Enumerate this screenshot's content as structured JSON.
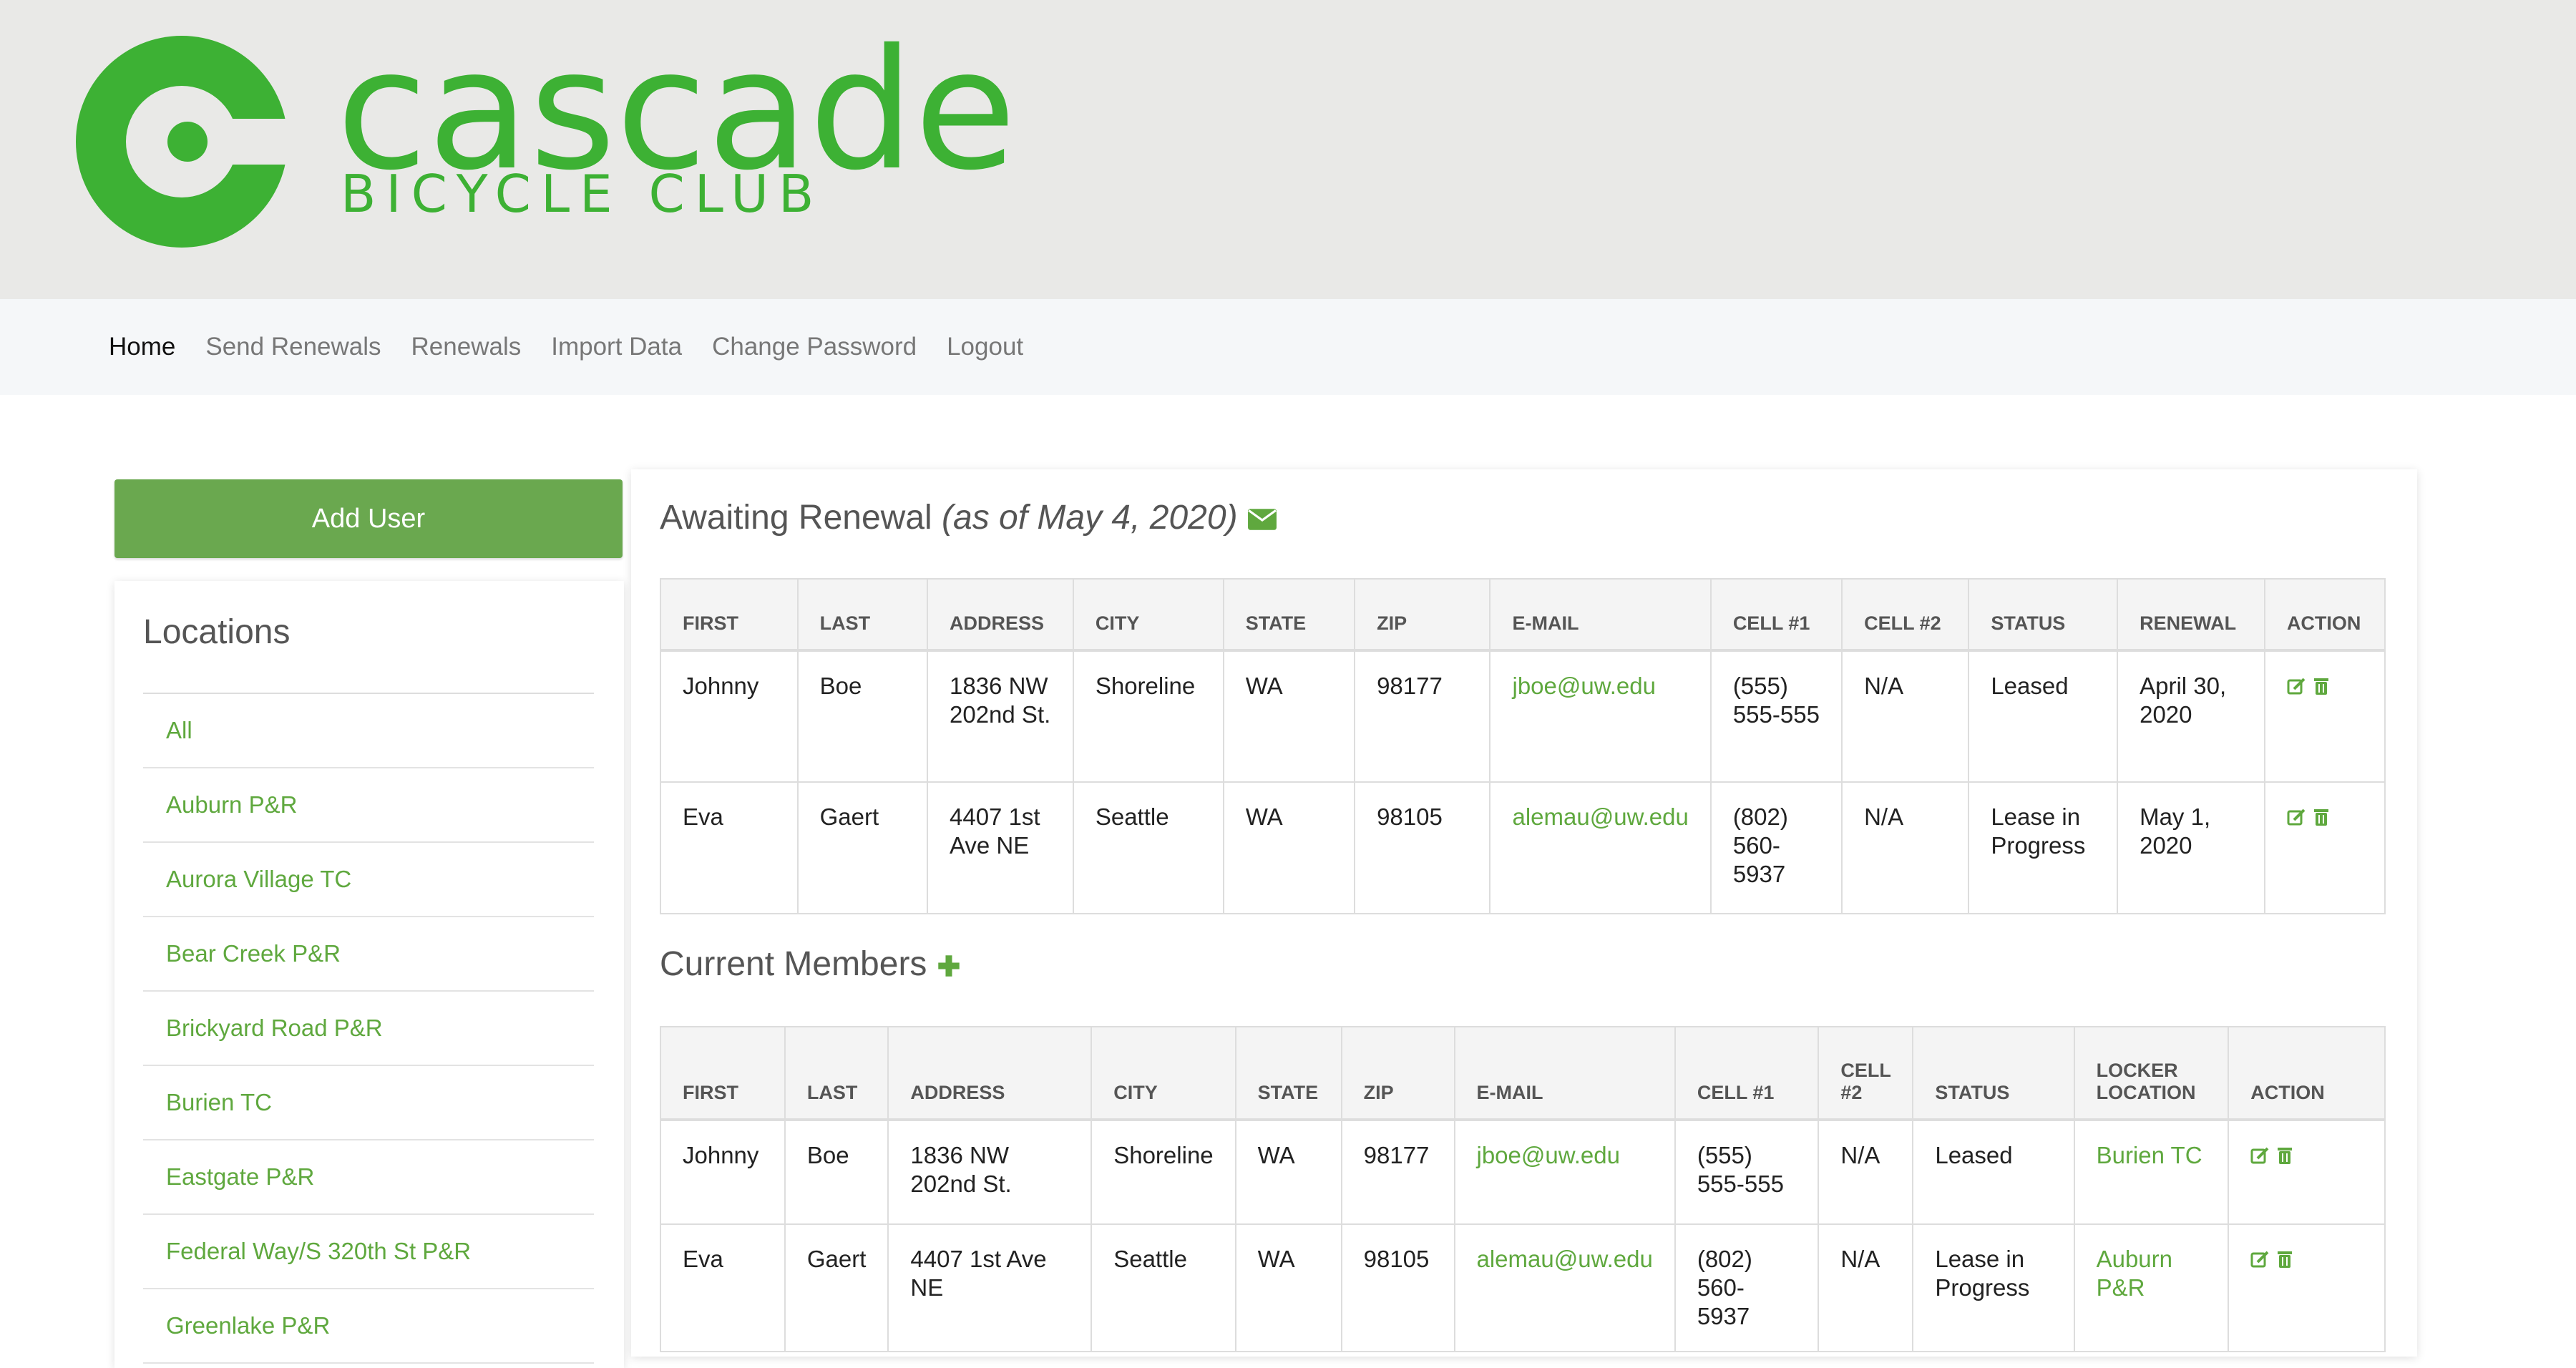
{
  "brand": {
    "wordmark": "cascade",
    "subtitle": "BICYCLE CLUB",
    "color": "#3db134",
    "logo_icon": "cascade-logo-icon"
  },
  "nav": [
    {
      "label": "Home",
      "active": true
    },
    {
      "label": "Send Renewals"
    },
    {
      "label": "Renewals"
    },
    {
      "label": "Import Data"
    },
    {
      "label": "Change Password"
    },
    {
      "label": "Logout"
    }
  ],
  "sidebar": {
    "add_user_label": "Add User",
    "locations_title": "Locations",
    "locations": [
      "All",
      "Auburn P&R",
      "Aurora Village TC",
      "Bear Creek P&R",
      "Brickyard Road P&R",
      "Burien TC",
      "Eastgate P&R",
      "Federal Way/S 320th St P&R",
      "Greenlake P&R"
    ]
  },
  "awaiting": {
    "title": "Awaiting Renewal",
    "as_of": "(as of May 4, 2020)",
    "icon": "envelope-icon",
    "columns": [
      "FIRST",
      "LAST",
      "ADDRESS",
      "CITY",
      "STATE",
      "ZIP",
      "E-MAIL",
      "CELL #1",
      "CELL #2",
      "STATUS",
      "RENEWAL",
      "ACTION"
    ],
    "rows": [
      {
        "first": "Johnny",
        "last": "Boe",
        "address": "1836 NW 202nd St.",
        "city": "Shoreline",
        "state": "WA",
        "zip": "98177",
        "email": "jboe@uw.edu",
        "cell1": "(555) 555-555",
        "cell2": "N/A",
        "status": "Leased",
        "renewal": "April 30, 2020"
      },
      {
        "first": "Eva",
        "last": "Gaert",
        "address": "4407 1st Ave NE",
        "city": "Seattle",
        "state": "WA",
        "zip": "98105",
        "email": "alemau@uw.edu",
        "cell1": "(802) 560-5937",
        "cell2": "N/A",
        "status": "Lease in Progress",
        "renewal": "May 1, 2020"
      }
    ]
  },
  "current": {
    "title": "Current Members",
    "icon": "plus-icon",
    "columns": [
      "FIRST",
      "LAST",
      "ADDRESS",
      "CITY",
      "STATE",
      "ZIP",
      "E-MAIL",
      "CELL #1",
      "CELL #2",
      "STATUS",
      "LOCKER LOCATION",
      "ACTION"
    ],
    "rows": [
      {
        "first": "Johnny",
        "last": "Boe",
        "address": "1836 NW 202nd St.",
        "city": "Shoreline",
        "state": "WA",
        "zip": "98177",
        "email": "jboe@uw.edu",
        "cell1": "(555) 555-555",
        "cell2": "N/A",
        "status": "Leased",
        "locker": "Burien TC"
      },
      {
        "first": "Eva",
        "last": "Gaert",
        "address": "4407 1st Ave NE",
        "city": "Seattle",
        "state": "WA",
        "zip": "98105",
        "email": "alemau@uw.edu",
        "cell1": "(802) 560-5937",
        "cell2": "N/A",
        "status": "Lease in Progress",
        "locker": "Auburn P&R"
      }
    ]
  },
  "row_action_icons": [
    "edit-icon",
    "trash-icon"
  ],
  "accent_color": "#5fa83e"
}
